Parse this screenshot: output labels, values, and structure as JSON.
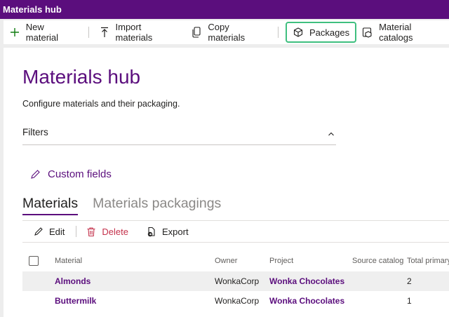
{
  "app": {
    "title": "Materials hub"
  },
  "toolbar": {
    "new_material": "New material",
    "import_materials": "Import materials",
    "copy_materials": "Copy materials",
    "packages": "Packages",
    "material_catalogs": "Material catalogs"
  },
  "page": {
    "title": "Materials hub",
    "description": "Configure materials and their packaging.",
    "filters_label": "Filters",
    "custom_fields": "Custom fields"
  },
  "tabs": {
    "materials": "Materials",
    "materials_packagings": "Materials packagings"
  },
  "actions": {
    "edit": "Edit",
    "delete": "Delete",
    "export": "Export"
  },
  "grid": {
    "headers": {
      "material": "Material",
      "owner": "Owner",
      "project": "Project",
      "source_catalog": "Source catalog",
      "total_primary": "Total primary"
    },
    "rows": [
      {
        "material": "Almonds",
        "owner": "WonkaCorp",
        "project": "Wonka Chocolates",
        "source_catalog": "",
        "total_primary": "2"
      },
      {
        "material": "Buttermilk",
        "owner": "WonkaCorp",
        "project": "Wonka Chocolates",
        "source_catalog": "",
        "total_primary": "1"
      }
    ]
  },
  "colors": {
    "brand": "#5b0e7d",
    "highlight": "#3fbf7f",
    "delete": "#c4314b"
  }
}
